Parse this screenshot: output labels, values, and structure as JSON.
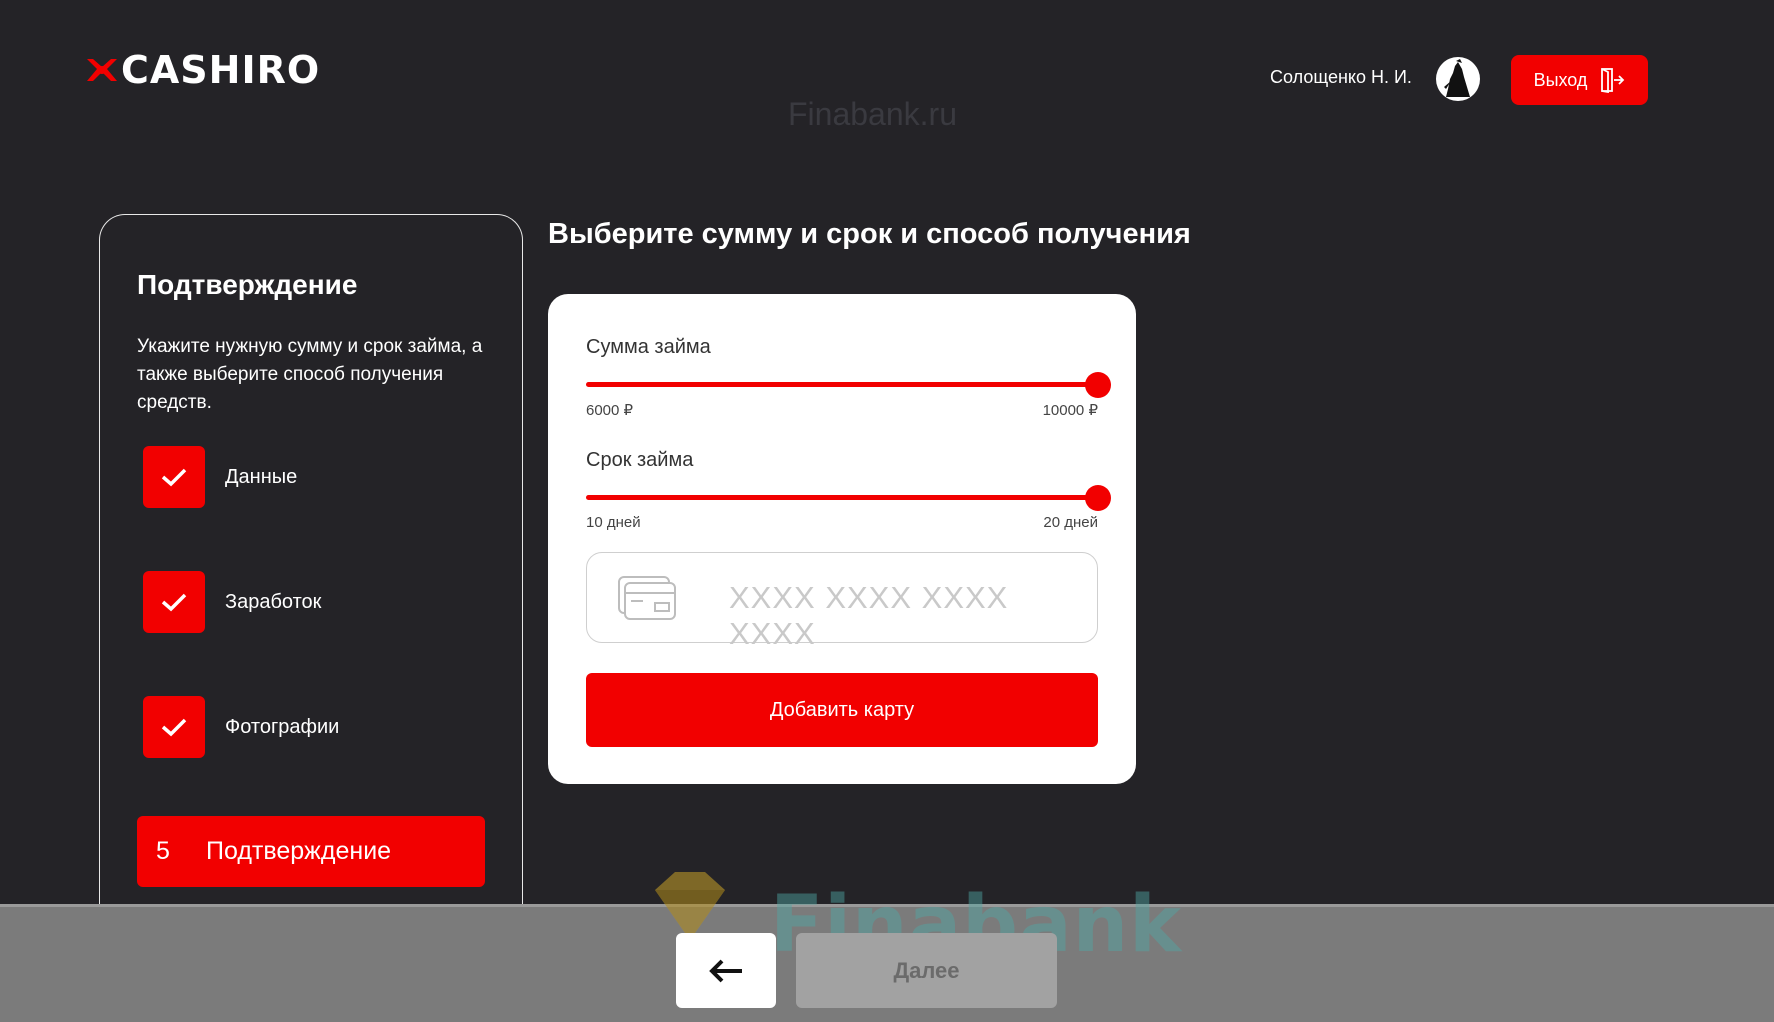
{
  "header": {
    "logo_text": "CASHIRO",
    "watermark": "Finabank.ru",
    "user_name": "Солощенко Н. И.",
    "logout_label": "Выход",
    "icons": {
      "logo": "ninja-mark-icon",
      "avatar": "samurai-avatar-icon",
      "logout": "exit-door-icon"
    }
  },
  "sidebar": {
    "title": "Подтверждение",
    "description": "Укажите нужную сумму и срок займа, а также выберите способ получения средств.",
    "steps": [
      {
        "label": "Данные",
        "status": "done"
      },
      {
        "label": "Заработок",
        "status": "done"
      },
      {
        "label": "Фотографии",
        "status": "done"
      }
    ],
    "active_step": {
      "number": "5",
      "label": "Подтверждение"
    }
  },
  "main": {
    "heading": "Выберите сумму и срок и способ получения",
    "amount": {
      "label": "Сумма займа",
      "min": "6000 ₽",
      "max": "10000 ₽",
      "value_fraction": 1.0
    },
    "term": {
      "label": "Срок займа",
      "min": "10 дней",
      "max": "20 дней",
      "value_fraction": 1.0
    },
    "card_input": {
      "placeholder": "XXXX XXXX XXXX XXXX"
    },
    "add_card_label": "Добавить карту"
  },
  "footer": {
    "back_icon": "arrow-left-icon",
    "next_label": "Далее",
    "watermark_text": "Finabank"
  },
  "colors": {
    "accent": "#f20000",
    "background": "#242327",
    "card": "#ffffff"
  }
}
